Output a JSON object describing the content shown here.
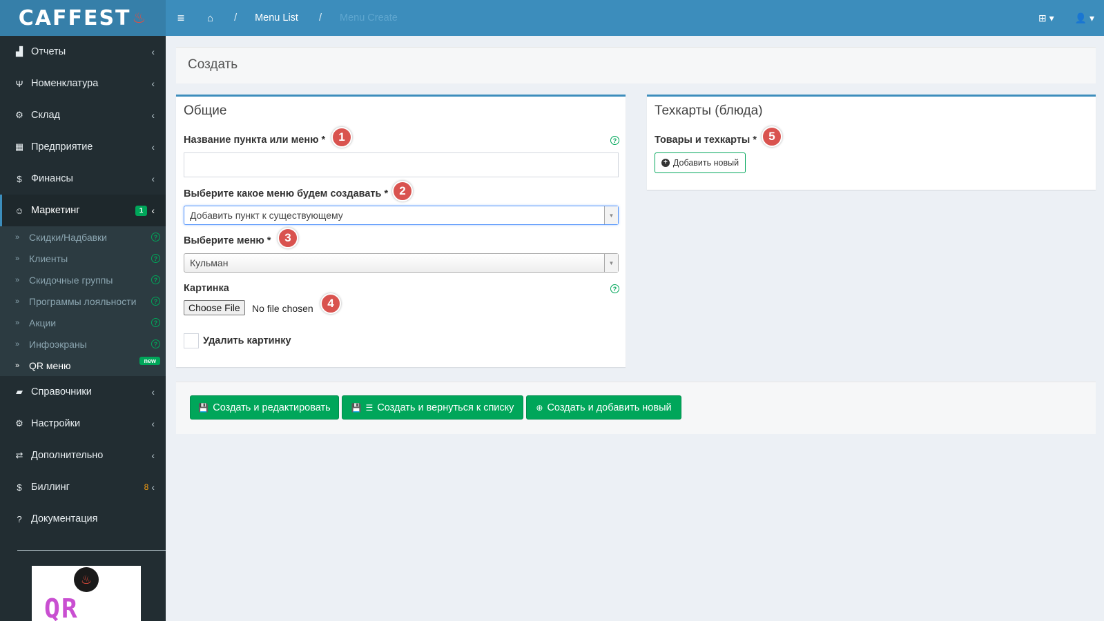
{
  "logo": {
    "text": "CAFFEST"
  },
  "sidebar": {
    "items": [
      {
        "label": "Отчеты",
        "icon": "chart-icon",
        "glyph": "▟"
      },
      {
        "label": "Номенклатура",
        "icon": "cutlery-icon",
        "glyph": "🍴"
      },
      {
        "label": "Склад",
        "icon": "boxes-icon",
        "glyph": "⚙"
      },
      {
        "label": "Предприятие",
        "icon": "building-icon",
        "glyph": "▦"
      },
      {
        "label": "Финансы",
        "icon": "dollar-icon",
        "glyph": "$"
      },
      {
        "label": "Маркетинг",
        "icon": "smile-icon",
        "glyph": "☺",
        "badge": "1"
      }
    ],
    "marketing_sub": [
      {
        "label": "Скидки/Надбавки"
      },
      {
        "label": "Клиенты"
      },
      {
        "label": "Скидочные группы"
      },
      {
        "label": "Программы лояльности"
      },
      {
        "label": "Акции"
      },
      {
        "label": "Инфоэкраны"
      },
      {
        "label": "QR меню",
        "badge": "new"
      }
    ],
    "items2": [
      {
        "label": "Справочники",
        "icon": "book-icon",
        "glyph": "▰"
      },
      {
        "label": "Настройки",
        "icon": "gear-icon",
        "glyph": "⚙"
      },
      {
        "label": "Дополнительно",
        "icon": "exchange-icon",
        "glyph": "⇄"
      },
      {
        "label": "Биллинг",
        "icon": "dollar-icon",
        "glyph": "$",
        "count": "8"
      },
      {
        "label": "Документация",
        "icon": "question-icon",
        "glyph": "?"
      }
    ]
  },
  "navbar": {
    "breadcrumb_menu_list": "Menu List",
    "breadcrumb_current": "Menu Create"
  },
  "page": {
    "title": "Создать"
  },
  "general": {
    "heading": "Общие",
    "name_label": "Название пункта или меню *",
    "name_value": "",
    "menu_type_label": "Выберите какое меню будем создавать *",
    "menu_type_value": "Добавить пункт к существующему",
    "menu_label": "Выберите меню *",
    "menu_value": "Кульман",
    "image_label": "Картинка",
    "file_button": "Choose File",
    "file_status": "No file chosen",
    "delete_image_label": "Удалить картинку"
  },
  "techcards": {
    "heading": "Техкарты (блюда)",
    "goods_label": "Товары и техкарты *",
    "add_button": "Добавить новый"
  },
  "markers": [
    "1",
    "2",
    "3",
    "4",
    "5"
  ],
  "actions": {
    "create_edit": "Создать и редактировать",
    "create_back": "Создать и вернуться к списку",
    "create_new": "Создать и добавить новый"
  },
  "colors": {
    "navbar": "#3c8dbc",
    "sidebar": "#222d32",
    "success": "#00a65a",
    "marker": "#d9534f"
  }
}
